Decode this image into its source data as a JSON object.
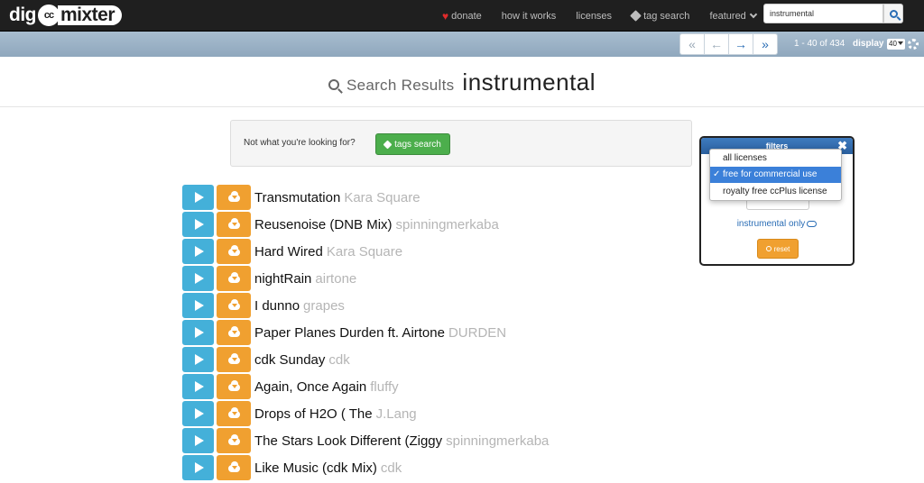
{
  "logo": {
    "dig": "dig",
    "cc": "cc",
    "mixter": "mixter"
  },
  "nav": {
    "donate": "donate",
    "how_it_works": "how it works",
    "licenses": "licenses",
    "tag_search": "tag search",
    "featured": "featured"
  },
  "search": {
    "value": "instrumental"
  },
  "pager": {
    "first": "«",
    "prev": "←",
    "next": "→",
    "last": "»",
    "range": "1 - 40 of 434",
    "display_label": "display",
    "display_value": "40"
  },
  "heading": {
    "label": "Search Results",
    "term": "instrumental"
  },
  "not_found": {
    "text": "Not what you're looking for?",
    "button": "tags search"
  },
  "results": [
    {
      "title": "Transmutation",
      "artist": "Kara Square"
    },
    {
      "title": "Reusenoise (DNB Mix)",
      "artist": "spinningmerkaba"
    },
    {
      "title": "Hard Wired",
      "artist": "Kara Square"
    },
    {
      "title": "nightRain",
      "artist": "airtone"
    },
    {
      "title": "I dunno",
      "artist": "grapes"
    },
    {
      "title": "Paper Planes Durden ft. Airtone",
      "artist": "DURDEN"
    },
    {
      "title": "cdk Sunday",
      "artist": "cdk"
    },
    {
      "title": "Again, Once Again",
      "artist": "fluffy"
    },
    {
      "title": "Drops of H2O ( The",
      "artist": "J.Lang"
    },
    {
      "title": "The Stars Look Different (Ziggy",
      "artist": "spinningmerkaba"
    },
    {
      "title": "Like Music (cdk Mix)",
      "artist": "cdk"
    }
  ],
  "filters": {
    "title": "filters",
    "close": "✖",
    "instrumental_only": "instrumental only",
    "reset": "reset",
    "license_options": [
      "all licenses",
      "free for commercial use",
      "royalty free ccPlus license"
    ],
    "selected_check": "✓"
  },
  "colors": {
    "play": "#44b0d9",
    "download": "#f0a030",
    "tags_button": "#4cae4c",
    "navbar": "#1f1f1f",
    "filters_header": "#2a5f9e"
  }
}
